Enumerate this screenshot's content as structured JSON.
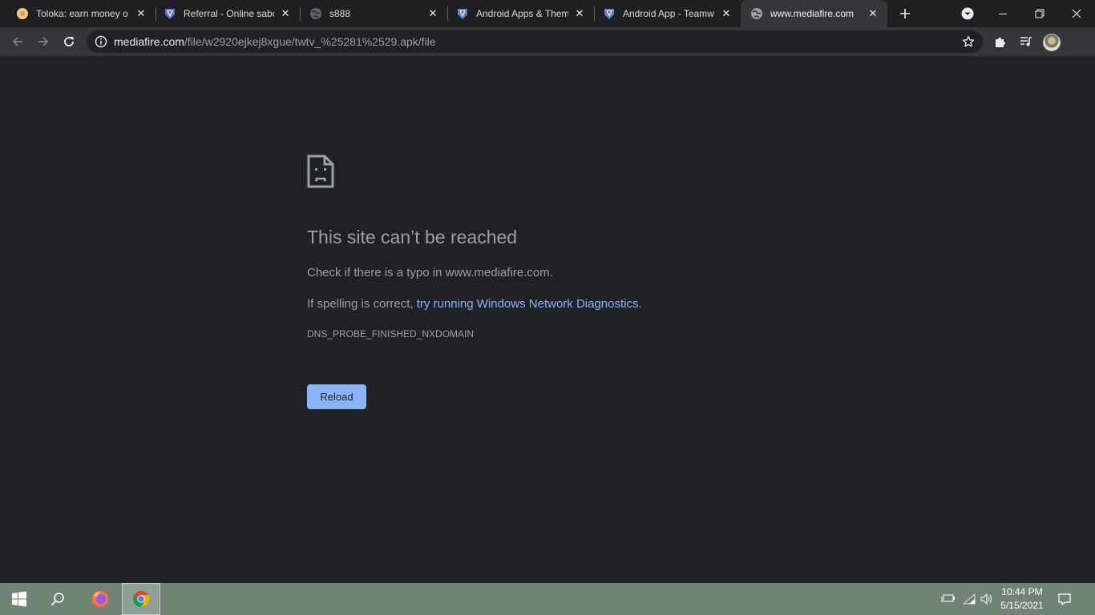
{
  "tabs": [
    {
      "title": "Toloka: earn money o",
      "favicon": "toloka-icon"
    },
    {
      "title": "Referral - Online sabo",
      "favicon": "shield-logo-icon"
    },
    {
      "title": "s888",
      "favicon": "globe-icon"
    },
    {
      "title": "Android Apps & Them",
      "favicon": "shield-logo-icon"
    },
    {
      "title": "Android App - Teamw",
      "favicon": "shield-logo-icon"
    },
    {
      "title": "www.mediafire.com",
      "favicon": "globe-icon",
      "active": true
    }
  ],
  "address_bar": {
    "host": "mediafire.com",
    "path": "/file/w2920ejkej8xgue/twtv_%25281%2529.apk/file"
  },
  "error_page": {
    "title": "This site can’t be reached",
    "line1": "Check if there is a typo in www.mediafire.com.",
    "line2_prefix": "If spelling is correct, ",
    "line2_link": "try running Windows Network Diagnostics",
    "line2_suffix": ".",
    "error_code": "DNS_PROBE_FINISHED_NXDOMAIN",
    "reload_label": "Reload"
  },
  "taskbar": {
    "time": "10:44 PM",
    "date": "5/15/2021"
  },
  "colors": {
    "page_bg": "#202124",
    "toolbar_bg": "#35363a",
    "link": "#8ab4f8",
    "taskbar_bg": "#6f8475"
  }
}
